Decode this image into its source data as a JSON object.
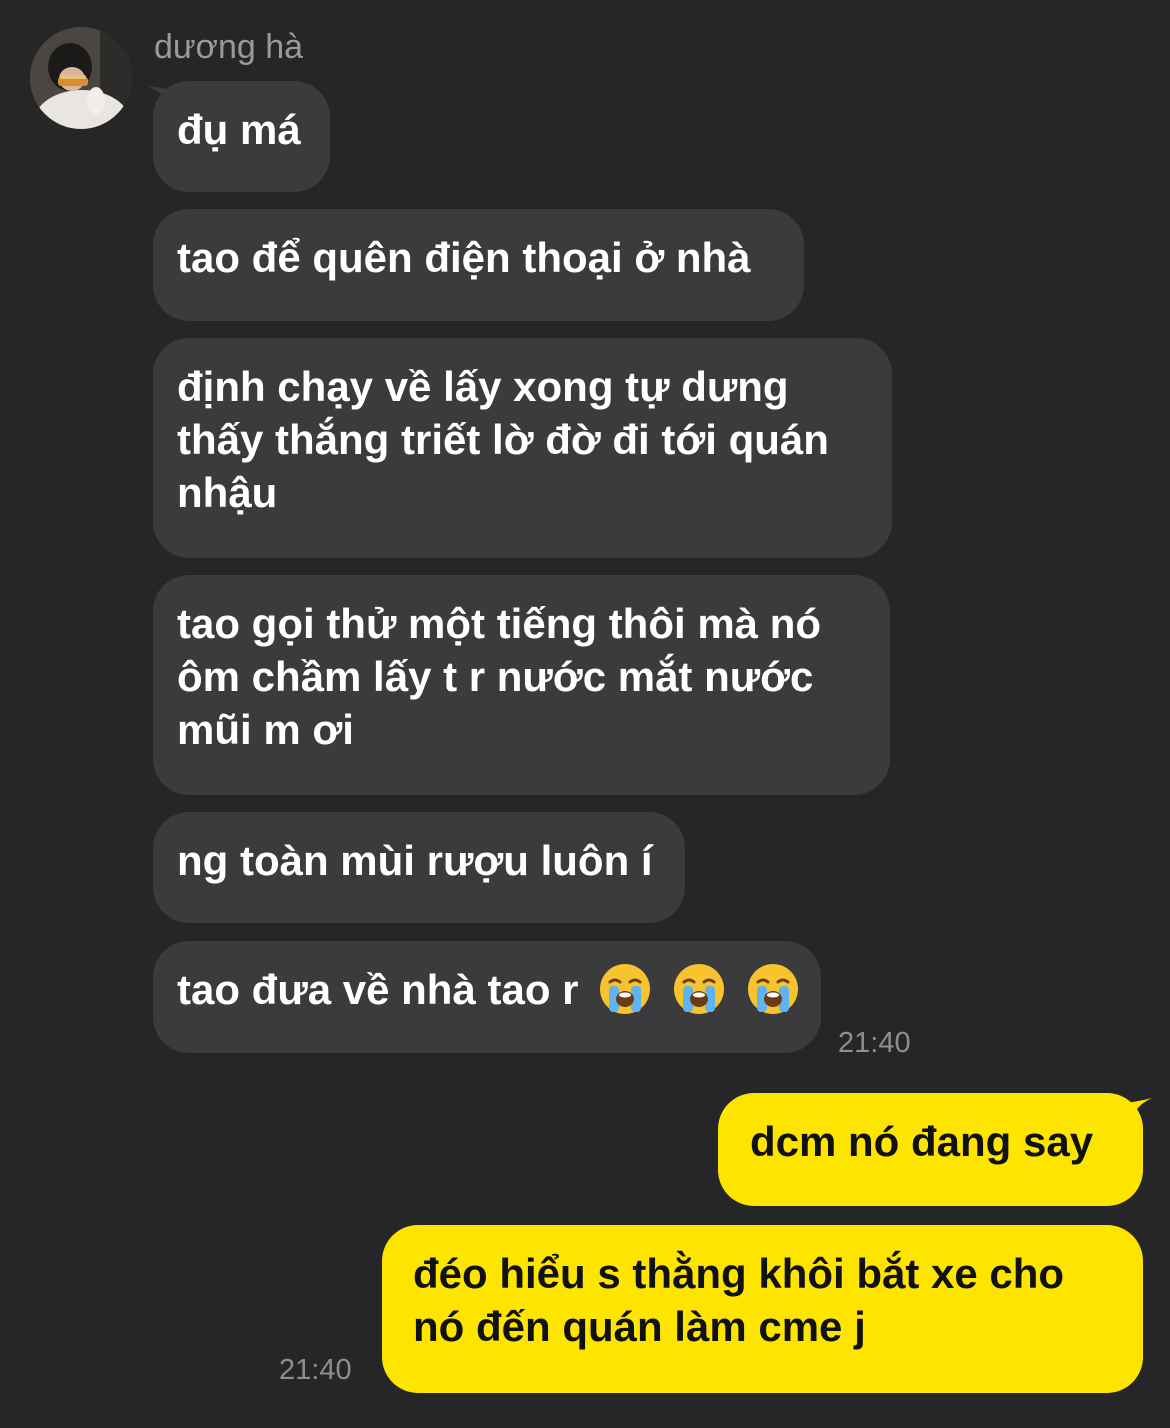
{
  "contact": {
    "name": "dương hà",
    "avatar_icon": "profile-photo"
  },
  "incoming": {
    "messages": [
      "đụ má",
      "tao để quên điện thoại ở nhà",
      "định chạy về lấy xong tự dưng\nthấy thắng triết lờ đờ đi tới quán\nnhậu",
      "tao gọi thử một tiếng thôi mà nó\nôm chầm lấy t r nước mắt nước\nmũi m ơi",
      "ng toàn mùi rượu luôn í",
      "tao đưa về nhà tao r"
    ],
    "last_emojis": [
      "loudly-crying-face",
      "loudly-crying-face",
      "loudly-crying-face"
    ],
    "time": "21:40"
  },
  "outgoing": {
    "messages": [
      "dcm nó đang say",
      "đéo hiểu s thằng khôi bắt xe cho\nnó đến quán làm cme j"
    ],
    "time": "21:40"
  },
  "colors": {
    "background": "#262628",
    "incoming_bubble": "#3b3b3d",
    "outgoing_bubble": "#fee500",
    "timestamp": "#8e8e90"
  }
}
